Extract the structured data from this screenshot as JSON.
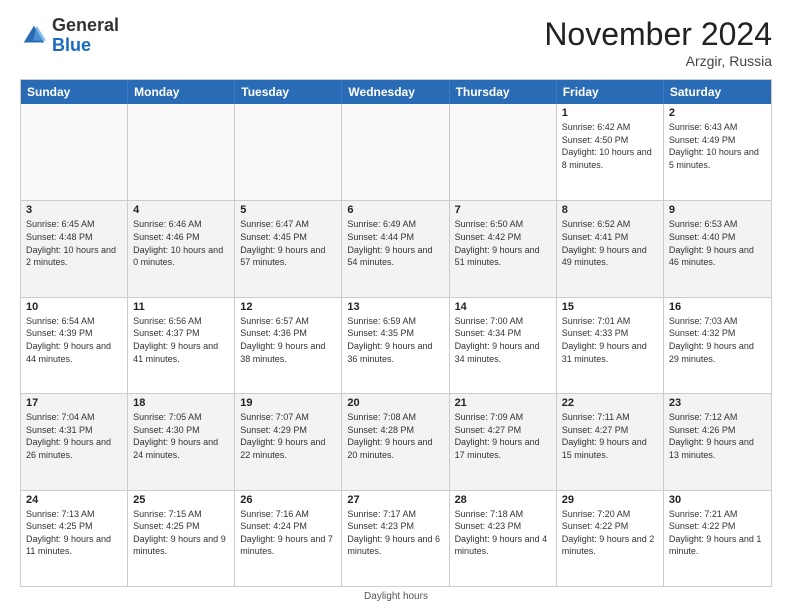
{
  "logo": {
    "general": "General",
    "blue": "Blue"
  },
  "title": "November 2024",
  "location": "Arzgir, Russia",
  "days_of_week": [
    "Sunday",
    "Monday",
    "Tuesday",
    "Wednesday",
    "Thursday",
    "Friday",
    "Saturday"
  ],
  "footer": "Daylight hours",
  "weeks": [
    [
      {
        "day": "",
        "sunrise": "",
        "sunset": "",
        "daylight": "",
        "empty": true
      },
      {
        "day": "",
        "sunrise": "",
        "sunset": "",
        "daylight": "",
        "empty": true
      },
      {
        "day": "",
        "sunrise": "",
        "sunset": "",
        "daylight": "",
        "empty": true
      },
      {
        "day": "",
        "sunrise": "",
        "sunset": "",
        "daylight": "",
        "empty": true
      },
      {
        "day": "",
        "sunrise": "",
        "sunset": "",
        "daylight": "",
        "empty": true
      },
      {
        "day": "1",
        "sunrise": "Sunrise: 6:42 AM",
        "sunset": "Sunset: 4:50 PM",
        "daylight": "Daylight: 10 hours and 8 minutes."
      },
      {
        "day": "2",
        "sunrise": "Sunrise: 6:43 AM",
        "sunset": "Sunset: 4:49 PM",
        "daylight": "Daylight: 10 hours and 5 minutes."
      }
    ],
    [
      {
        "day": "3",
        "sunrise": "Sunrise: 6:45 AM",
        "sunset": "Sunset: 4:48 PM",
        "daylight": "Daylight: 10 hours and 2 minutes."
      },
      {
        "day": "4",
        "sunrise": "Sunrise: 6:46 AM",
        "sunset": "Sunset: 4:46 PM",
        "daylight": "Daylight: 10 hours and 0 minutes."
      },
      {
        "day": "5",
        "sunrise": "Sunrise: 6:47 AM",
        "sunset": "Sunset: 4:45 PM",
        "daylight": "Daylight: 9 hours and 57 minutes."
      },
      {
        "day": "6",
        "sunrise": "Sunrise: 6:49 AM",
        "sunset": "Sunset: 4:44 PM",
        "daylight": "Daylight: 9 hours and 54 minutes."
      },
      {
        "day": "7",
        "sunrise": "Sunrise: 6:50 AM",
        "sunset": "Sunset: 4:42 PM",
        "daylight": "Daylight: 9 hours and 51 minutes."
      },
      {
        "day": "8",
        "sunrise": "Sunrise: 6:52 AM",
        "sunset": "Sunset: 4:41 PM",
        "daylight": "Daylight: 9 hours and 49 minutes."
      },
      {
        "day": "9",
        "sunrise": "Sunrise: 6:53 AM",
        "sunset": "Sunset: 4:40 PM",
        "daylight": "Daylight: 9 hours and 46 minutes."
      }
    ],
    [
      {
        "day": "10",
        "sunrise": "Sunrise: 6:54 AM",
        "sunset": "Sunset: 4:39 PM",
        "daylight": "Daylight: 9 hours and 44 minutes."
      },
      {
        "day": "11",
        "sunrise": "Sunrise: 6:56 AM",
        "sunset": "Sunset: 4:37 PM",
        "daylight": "Daylight: 9 hours and 41 minutes."
      },
      {
        "day": "12",
        "sunrise": "Sunrise: 6:57 AM",
        "sunset": "Sunset: 4:36 PM",
        "daylight": "Daylight: 9 hours and 38 minutes."
      },
      {
        "day": "13",
        "sunrise": "Sunrise: 6:59 AM",
        "sunset": "Sunset: 4:35 PM",
        "daylight": "Daylight: 9 hours and 36 minutes."
      },
      {
        "day": "14",
        "sunrise": "Sunrise: 7:00 AM",
        "sunset": "Sunset: 4:34 PM",
        "daylight": "Daylight: 9 hours and 34 minutes."
      },
      {
        "day": "15",
        "sunrise": "Sunrise: 7:01 AM",
        "sunset": "Sunset: 4:33 PM",
        "daylight": "Daylight: 9 hours and 31 minutes."
      },
      {
        "day": "16",
        "sunrise": "Sunrise: 7:03 AM",
        "sunset": "Sunset: 4:32 PM",
        "daylight": "Daylight: 9 hours and 29 minutes."
      }
    ],
    [
      {
        "day": "17",
        "sunrise": "Sunrise: 7:04 AM",
        "sunset": "Sunset: 4:31 PM",
        "daylight": "Daylight: 9 hours and 26 minutes."
      },
      {
        "day": "18",
        "sunrise": "Sunrise: 7:05 AM",
        "sunset": "Sunset: 4:30 PM",
        "daylight": "Daylight: 9 hours and 24 minutes."
      },
      {
        "day": "19",
        "sunrise": "Sunrise: 7:07 AM",
        "sunset": "Sunset: 4:29 PM",
        "daylight": "Daylight: 9 hours and 22 minutes."
      },
      {
        "day": "20",
        "sunrise": "Sunrise: 7:08 AM",
        "sunset": "Sunset: 4:28 PM",
        "daylight": "Daylight: 9 hours and 20 minutes."
      },
      {
        "day": "21",
        "sunrise": "Sunrise: 7:09 AM",
        "sunset": "Sunset: 4:27 PM",
        "daylight": "Daylight: 9 hours and 17 minutes."
      },
      {
        "day": "22",
        "sunrise": "Sunrise: 7:11 AM",
        "sunset": "Sunset: 4:27 PM",
        "daylight": "Daylight: 9 hours and 15 minutes."
      },
      {
        "day": "23",
        "sunrise": "Sunrise: 7:12 AM",
        "sunset": "Sunset: 4:26 PM",
        "daylight": "Daylight: 9 hours and 13 minutes."
      }
    ],
    [
      {
        "day": "24",
        "sunrise": "Sunrise: 7:13 AM",
        "sunset": "Sunset: 4:25 PM",
        "daylight": "Daylight: 9 hours and 11 minutes."
      },
      {
        "day": "25",
        "sunrise": "Sunrise: 7:15 AM",
        "sunset": "Sunset: 4:25 PM",
        "daylight": "Daylight: 9 hours and 9 minutes."
      },
      {
        "day": "26",
        "sunrise": "Sunrise: 7:16 AM",
        "sunset": "Sunset: 4:24 PM",
        "daylight": "Daylight: 9 hours and 7 minutes."
      },
      {
        "day": "27",
        "sunrise": "Sunrise: 7:17 AM",
        "sunset": "Sunset: 4:23 PM",
        "daylight": "Daylight: 9 hours and 6 minutes."
      },
      {
        "day": "28",
        "sunrise": "Sunrise: 7:18 AM",
        "sunset": "Sunset: 4:23 PM",
        "daylight": "Daylight: 9 hours and 4 minutes."
      },
      {
        "day": "29",
        "sunrise": "Sunrise: 7:20 AM",
        "sunset": "Sunset: 4:22 PM",
        "daylight": "Daylight: 9 hours and 2 minutes."
      },
      {
        "day": "30",
        "sunrise": "Sunrise: 7:21 AM",
        "sunset": "Sunset: 4:22 PM",
        "daylight": "Daylight: 9 hours and 1 minute."
      }
    ]
  ]
}
